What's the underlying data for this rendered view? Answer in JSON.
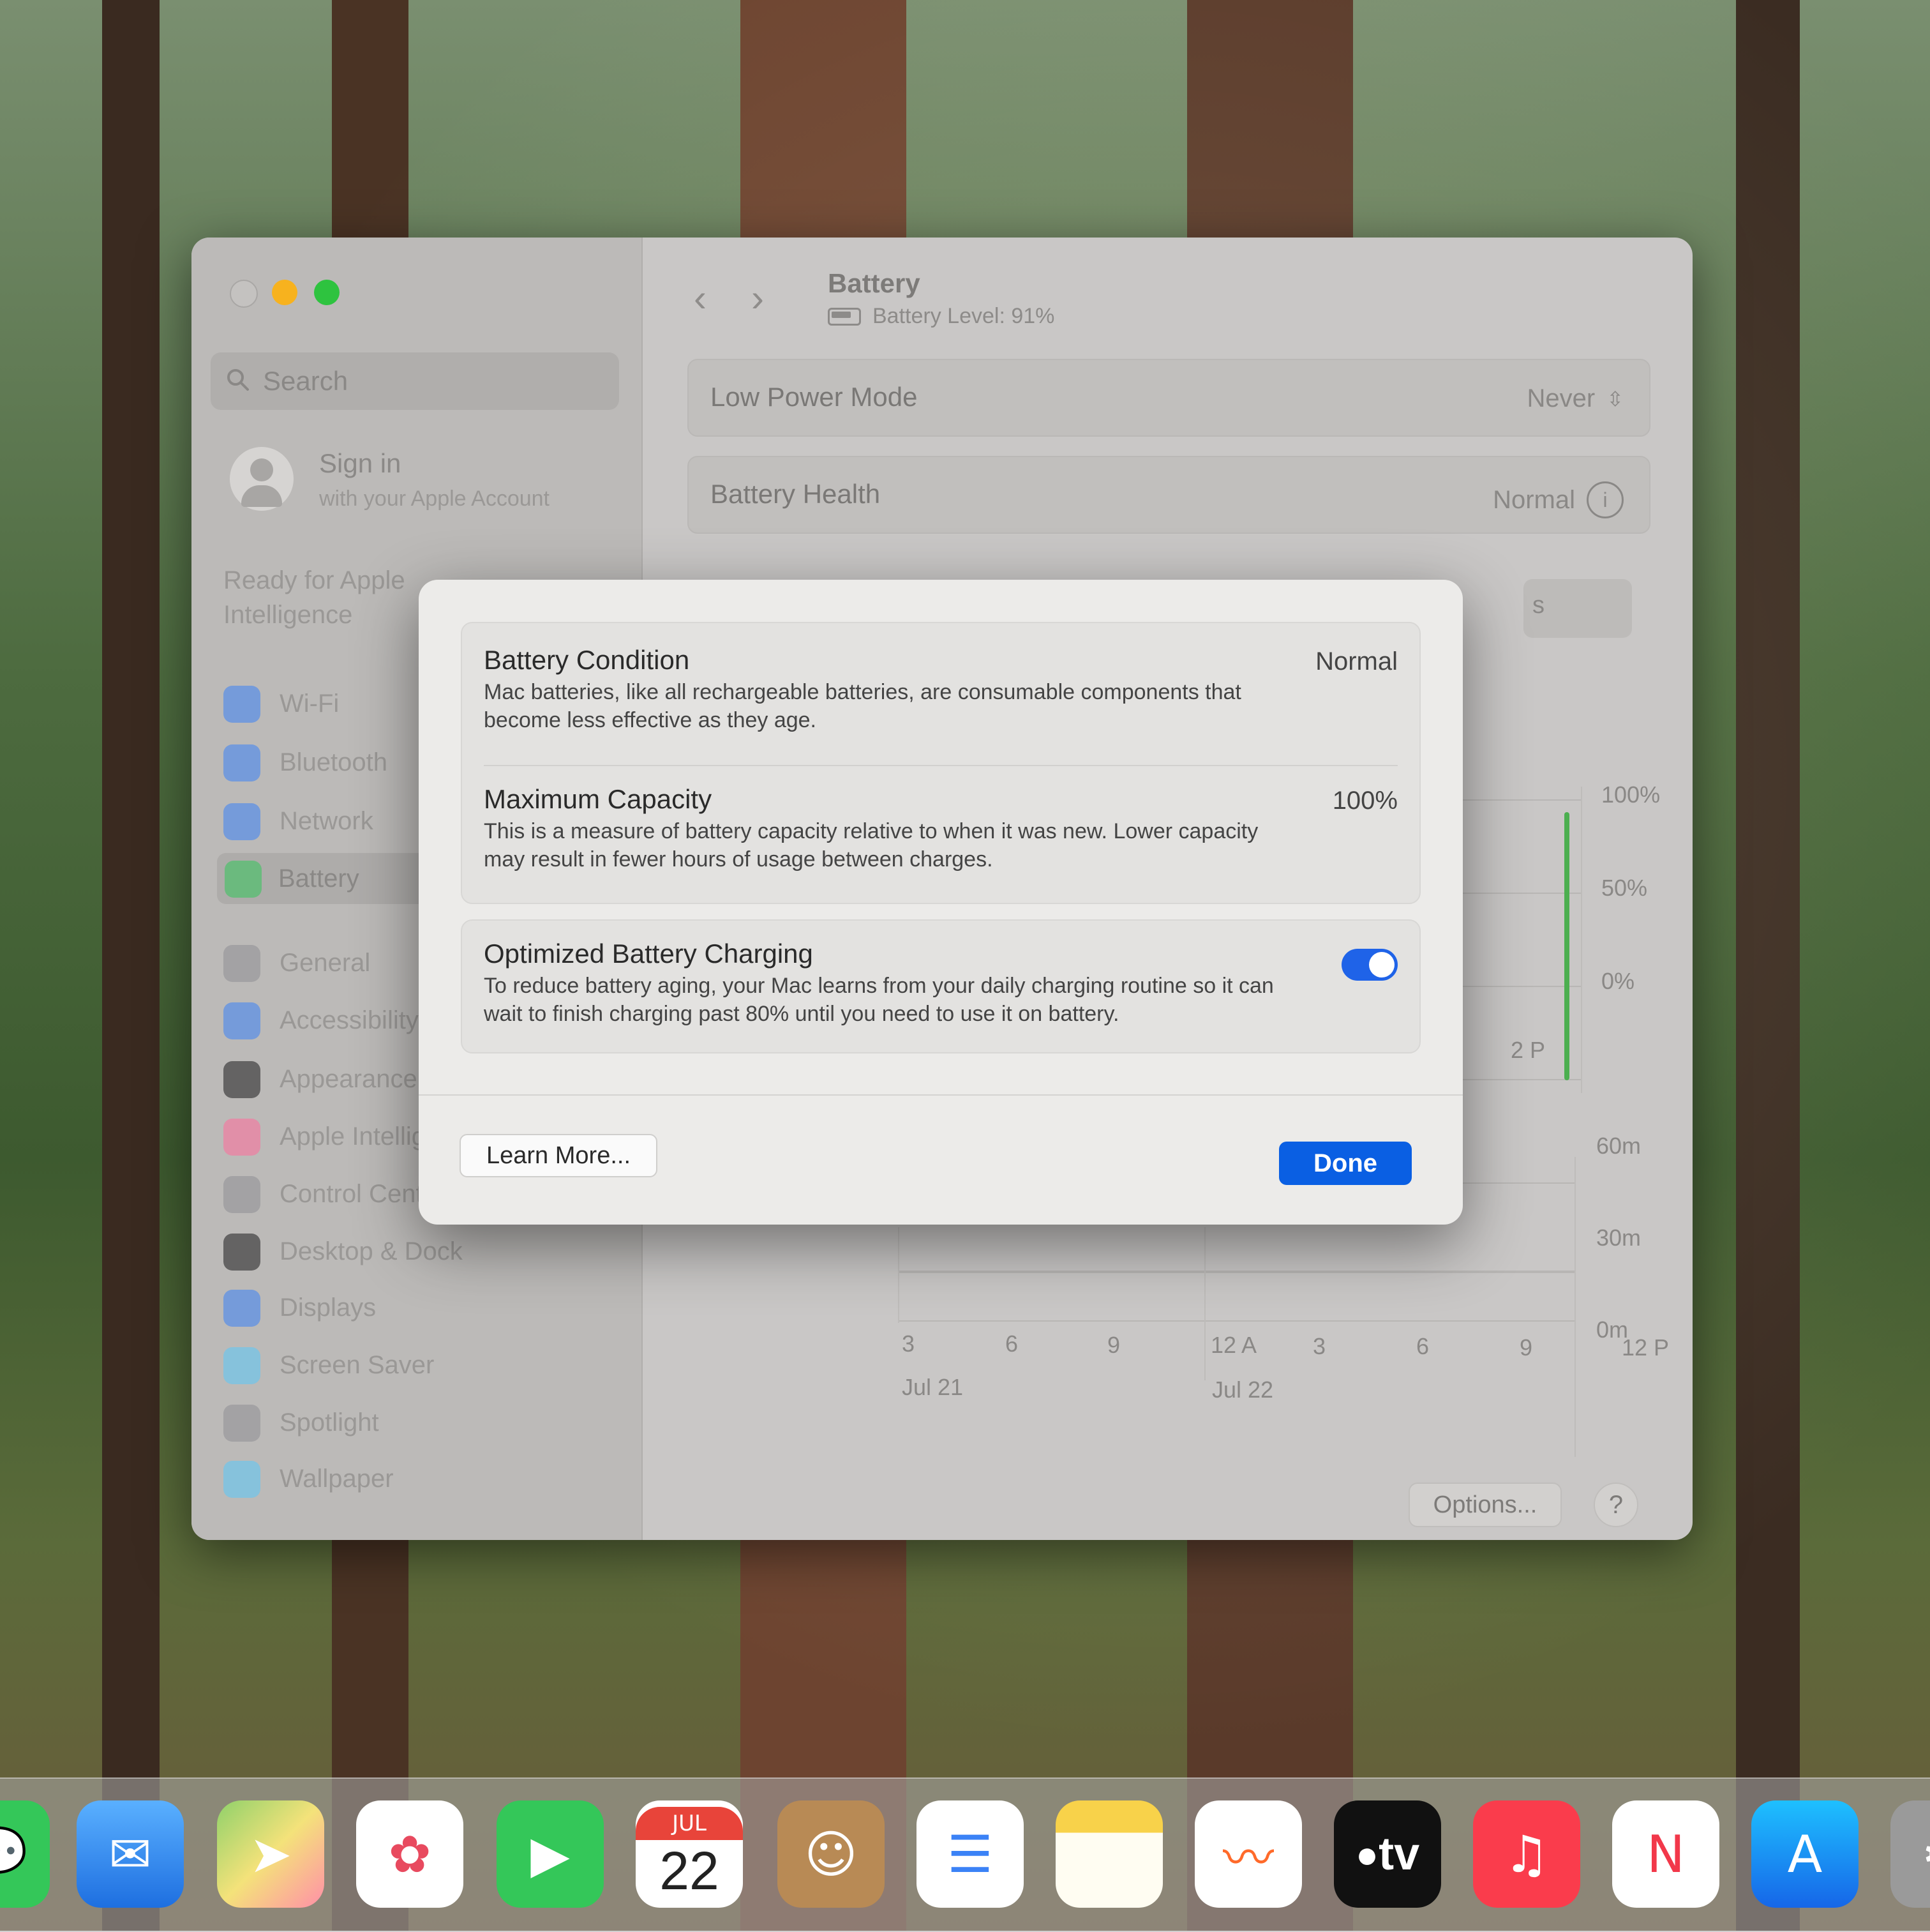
{
  "sidebar": {
    "search_placeholder": "Search",
    "account_name": "Sign in",
    "account_sub": "with your Apple Account",
    "ready_text": "Ready for Apple Intelligence",
    "items": [
      {
        "label": "Wi-Fi",
        "icon": "wifi-icon",
        "color": "#3b82f6"
      },
      {
        "label": "Bluetooth",
        "icon": "bluetooth-icon",
        "color": "#3b82f6"
      },
      {
        "label": "Network",
        "icon": "globe-icon",
        "color": "#3b82f6"
      },
      {
        "label": "Battery",
        "icon": "battery-icon",
        "color": "#34c759"
      },
      {
        "label": "General",
        "icon": "gear-icon",
        "color": "#8e8e93"
      },
      {
        "label": "Accessibility",
        "icon": "accessibility-icon",
        "color": "#3b82f6"
      },
      {
        "label": "Appearance",
        "icon": "appearance-icon",
        "color": "#1c1c1e"
      },
      {
        "label": "Apple Intelligence & Siri",
        "icon": "siri-icon",
        "color": "#ff6b9a"
      },
      {
        "label": "Control Center",
        "icon": "control-center-icon",
        "color": "#8e8e93"
      },
      {
        "label": "Desktop & Dock",
        "icon": "dock-icon",
        "color": "#1c1c1e"
      },
      {
        "label": "Displays",
        "icon": "sun-icon",
        "color": "#3b82f6"
      },
      {
        "label": "Screen Saver",
        "icon": "screensaver-icon",
        "color": "#5ac8fa"
      },
      {
        "label": "Spotlight",
        "icon": "magnifier-icon",
        "color": "#8e8e93"
      },
      {
        "label": "Wallpaper",
        "icon": "flower-icon",
        "color": "#5ac8fa"
      }
    ]
  },
  "header": {
    "title": "Battery",
    "level": "Battery Level: 91%"
  },
  "rows": {
    "low_power_label": "Low Power Mode",
    "low_power_value": "Never",
    "health_label": "Battery Health",
    "health_value": "Normal"
  },
  "segment_partial": "s",
  "chart": {
    "level_axis": [
      "100%",
      "50%",
      "0%"
    ],
    "usage_axis": [
      "60m",
      "30m",
      "0m"
    ],
    "partial_tick": "2 P",
    "x_ticks": [
      "3",
      "6",
      "9",
      "12 A",
      "3",
      "6",
      "9",
      "12 P"
    ],
    "date_labels": [
      "Jul 21",
      "Jul 22"
    ]
  },
  "modal": {
    "condition_title": "Battery Condition",
    "condition_value": "Normal",
    "condition_desc": "Mac batteries, like all rechargeable batteries, are consumable components that become less effective as they age.",
    "capacity_title": "Maximum Capacity",
    "capacity_value": "100%",
    "capacity_desc": "This is a measure of battery capacity relative to when it was new. Lower capacity may result in fewer hours of usage between charges.",
    "optimized_title": "Optimized Battery Charging",
    "optimized_desc": "To reduce battery aging, your Mac learns from your daily charging routine so it can wait to finish charging past 80% until you need to use it on battery.",
    "optimized_on": true,
    "learn_more": "Learn More...",
    "done": "Done"
  },
  "footer": {
    "options": "Options...",
    "help": "?"
  },
  "dock": {
    "calendar_month": "JUL",
    "calendar_day": "22",
    "tv_label": "tv"
  },
  "colors": {
    "accent": "#0a5fe3",
    "toggle_on": "#1f63e8",
    "battery_green": "#4caf50",
    "usage_blue": "#4f72d0"
  }
}
